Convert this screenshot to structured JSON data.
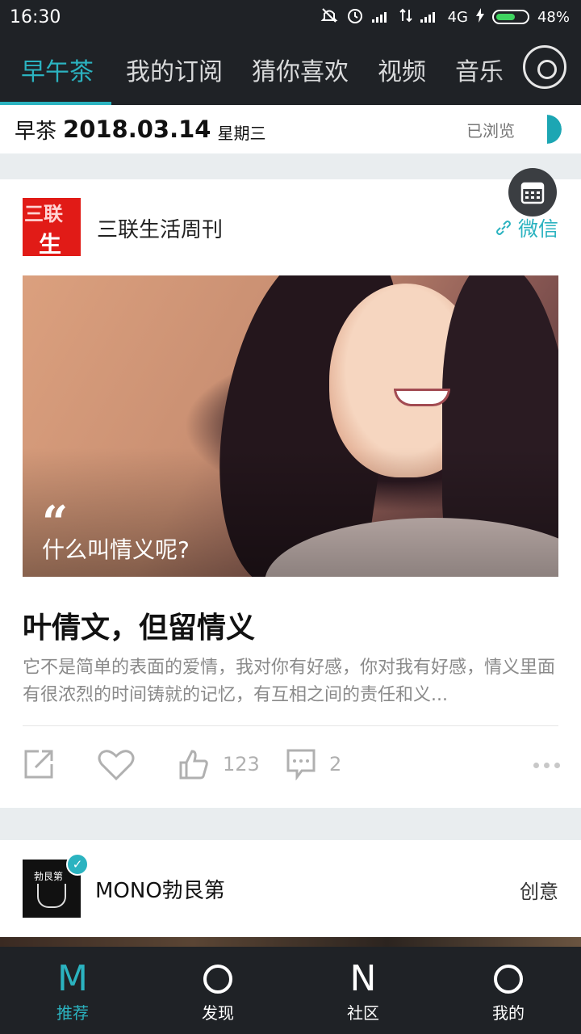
{
  "status_bar": {
    "time": "16:30",
    "network": "4G",
    "battery": "48%"
  },
  "top_nav": {
    "tabs": [
      {
        "label": "早午茶",
        "active": true
      },
      {
        "label": "我的订阅"
      },
      {
        "label": "猜你喜欢"
      },
      {
        "label": "视频"
      },
      {
        "label": "音乐"
      }
    ],
    "music_icon": "disc-icon"
  },
  "date_bar": {
    "label": "早茶",
    "date": "2018.03.14",
    "weekday": "星期三",
    "browsed": "已浏览",
    "browsed_progress": 0.5
  },
  "card": {
    "source_name": "三联生活周刊",
    "source_logo_text_1": "三联",
    "source_logo_text_2": "生活",
    "source_link": "微信",
    "quote": "什么叫情义呢?",
    "title": "叶倩文，但留情义",
    "summary": "它不是简单的表面的爱情，我对你有好感，你对我有好感，情义里面有很浓烈的时间铸就的记忆，有互相之间的责任和义...",
    "likes": "123",
    "comments": "2"
  },
  "card2": {
    "source_name": "MONO勃艮第",
    "tag": "创意",
    "logo_text": "勃艮第"
  },
  "bottom_nav": {
    "items": [
      {
        "icon": "M",
        "label": "推荐",
        "active": true
      },
      {
        "icon": "O",
        "label": "发现"
      },
      {
        "icon": "N",
        "label": "社区"
      },
      {
        "icon": "O",
        "label": "我的"
      }
    ]
  },
  "colors": {
    "accent": "#2bb3c0",
    "dark": "#1f2226",
    "logo_red": "#e11b17"
  }
}
